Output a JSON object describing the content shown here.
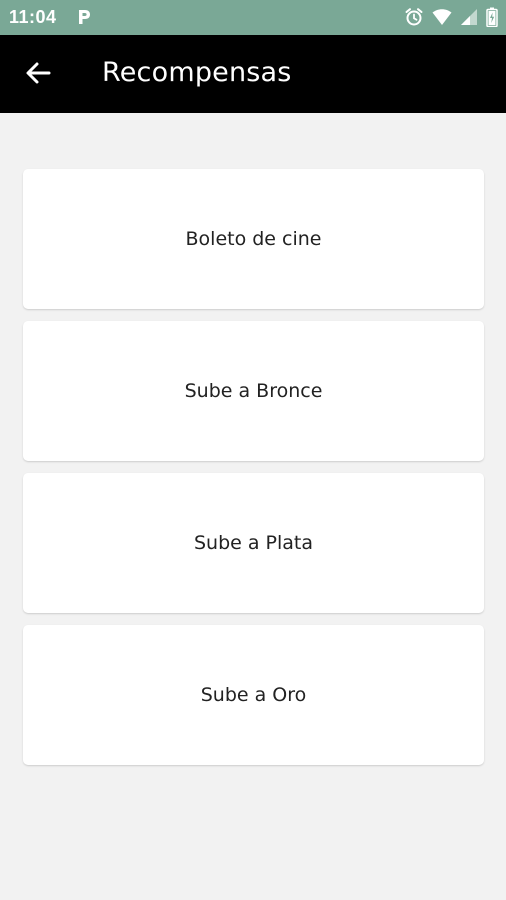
{
  "status_bar": {
    "time": "11:04",
    "bg_color": "#7aa896",
    "left_icons": [
      "parking-p-icon"
    ],
    "right_icons": [
      "alarm-icon",
      "wifi-icon",
      "signal-icon",
      "battery-icon"
    ]
  },
  "app_bar": {
    "title": "Recompensas",
    "back_icon": "arrow-left-icon",
    "bg_color": "#000000"
  },
  "rewards": {
    "items": [
      {
        "label": "Boleto de cine"
      },
      {
        "label": "Sube a Bronce"
      },
      {
        "label": "Sube a Plata"
      },
      {
        "label": "Sube a Oro"
      }
    ]
  }
}
